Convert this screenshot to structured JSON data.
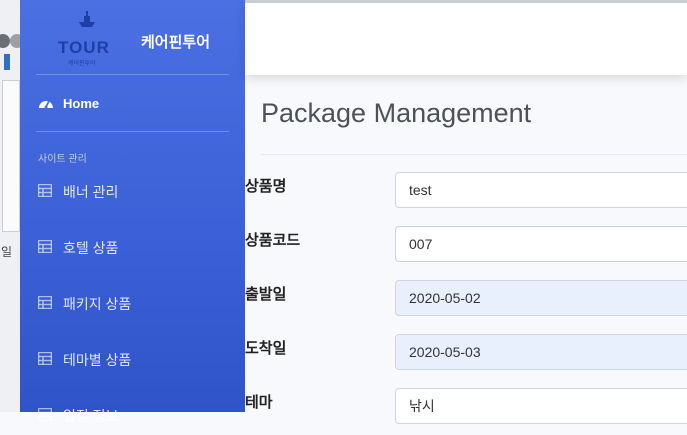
{
  "brand": {
    "logo_text": "TOUR",
    "logo_sub": "케어핀투어",
    "name": "케어핀투어"
  },
  "sidebar": {
    "home_label": "Home",
    "section_label": "사이트 관리",
    "items": [
      {
        "label": "배너 관리",
        "icon": "table-icon"
      },
      {
        "label": "호텔 상품",
        "icon": "table-icon"
      },
      {
        "label": "패키지 상품",
        "icon": "table-icon"
      },
      {
        "label": "테마별 상품",
        "icon": "table-icon"
      },
      {
        "label": "일정 정보",
        "icon": "table-icon"
      }
    ]
  },
  "main": {
    "title": "Package Management",
    "form": [
      {
        "label": "상품명",
        "value": "test",
        "type": "text"
      },
      {
        "label": "상품코드",
        "value": "007",
        "type": "text"
      },
      {
        "label": "출발일",
        "value": "2020-05-02",
        "type": "date"
      },
      {
        "label": "도착일",
        "value": "2020-05-03",
        "type": "date"
      },
      {
        "label": "테마",
        "value": "낚시",
        "type": "text"
      }
    ]
  },
  "background_window": {
    "partial_text": "일"
  },
  "colors": {
    "sidebar_top": "#4a70e2",
    "sidebar_bottom": "#2f53c8",
    "date_field_bg": "#e8f0fe"
  }
}
